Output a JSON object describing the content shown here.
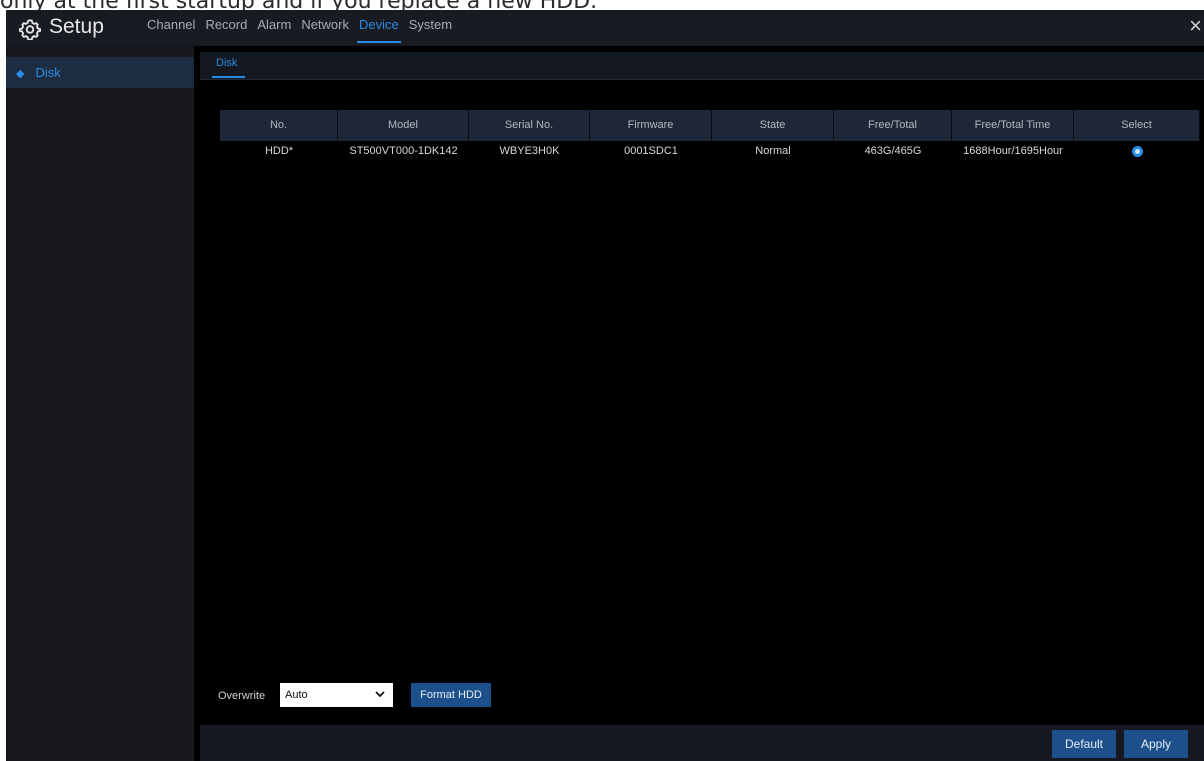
{
  "caption": "only at the first startup and if you replace a new HDD.",
  "header": {
    "title": "Setup",
    "menu": [
      {
        "label": "Channel"
      },
      {
        "label": "Record"
      },
      {
        "label": "Alarm"
      },
      {
        "label": "Network"
      },
      {
        "label": "Device",
        "active": true
      },
      {
        "label": "System"
      }
    ],
    "close_label": "×"
  },
  "sidebar": {
    "items": [
      {
        "label": "Disk",
        "icon": "diamond-icon",
        "active": true
      }
    ]
  },
  "main": {
    "tab": "Disk",
    "table": {
      "headers": [
        "No.",
        "Model",
        "Serial No.",
        "Firmware",
        "State",
        "Free/Total",
        "Free/Total Time",
        "Select"
      ],
      "rows": [
        [
          "HDD*",
          "ST500VT000-1DK142",
          "WBYE3H0K",
          "0001SDC1",
          "Normal",
          "463G/465G",
          "1688Hour/1695Hour",
          ""
        ]
      ]
    },
    "overwrite_label": "Overwrite",
    "overwrite_value": "Auto",
    "format_button": "Format HDD"
  },
  "footer": {
    "default_button": "Default",
    "apply_button": "Apply"
  },
  "colors": {
    "accent": "#2a8ce5",
    "button": "#1d4f8a",
    "background": "#000000"
  }
}
